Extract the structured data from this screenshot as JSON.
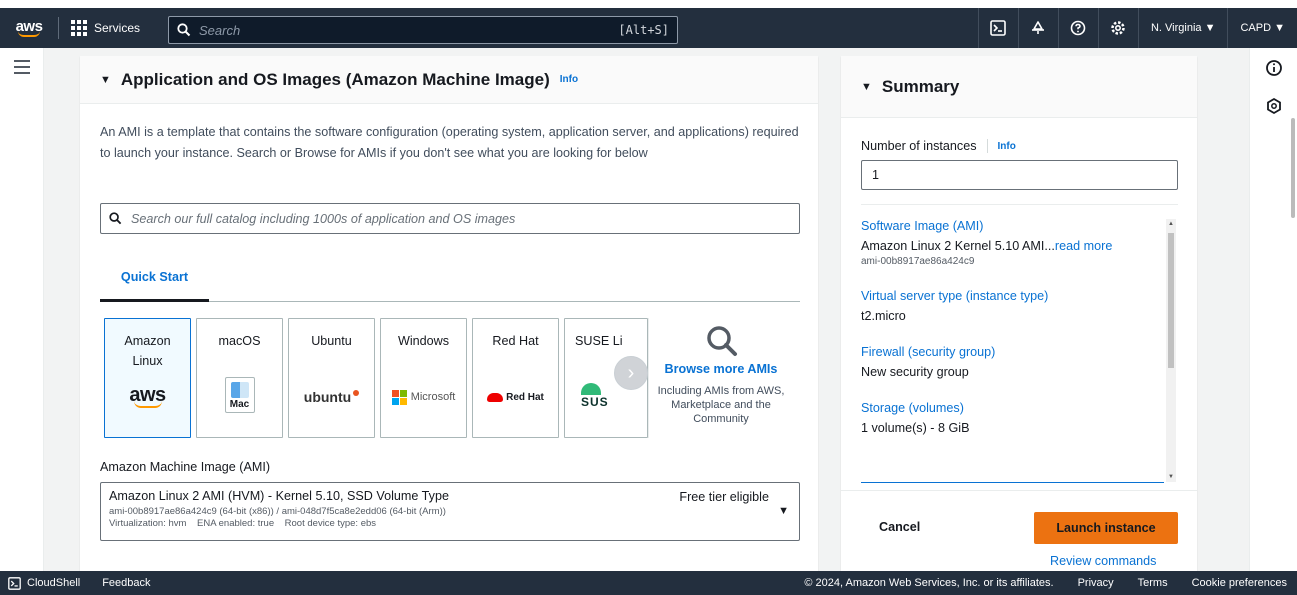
{
  "nav": {
    "logo_text": "aws",
    "services": "Services",
    "search_placeholder": "Search",
    "search_shortcut": "[Alt+S]",
    "region": "N. Virginia ▼",
    "account": "CAPD ▼"
  },
  "main": {
    "title": "Application and OS Images (Amazon Machine Image)",
    "info": "Info",
    "description": "An AMI is a template that contains the software configuration (operating system, application server, and applications) required to launch your instance. Search or Browse for AMIs if you don't see what you are looking for below",
    "catalog_placeholder": "Search our full catalog including 1000s of application and OS images",
    "tab": "Quick Start",
    "tiles": [
      {
        "label": "Amazon Linux",
        "logo": "aws"
      },
      {
        "label": "macOS",
        "logo": "Mac"
      },
      {
        "label": "Ubuntu",
        "logo": "ubuntu"
      },
      {
        "label": "Windows",
        "logo": "Microsoft"
      },
      {
        "label": "Red Hat",
        "logo": "Red Hat"
      },
      {
        "label": "SUSE Li",
        "logo": "SUS"
      }
    ],
    "browse_title": "Browse more AMIs",
    "browse_sub": "Including AMIs from AWS, Marketplace and the Community",
    "ami_label": "Amazon Machine Image (AMI)",
    "ami_name": "Amazon Linux 2 AMI (HVM) - Kernel 5.10, SSD Volume Type",
    "ami_free": "Free tier eligible",
    "ami_ids": "ami-00b8917ae86a424c9 (64-bit (x86)) / ami-048d7f5ca8e2edd06 (64-bit (Arm))",
    "ami_meta": "Virtualization: hvm    ENA enabled: true    Root device type: ebs"
  },
  "summary": {
    "title": "Summary",
    "num_label": "Number of instances",
    "info": "Info",
    "num_value": "1",
    "software_key": "Software Image (AMI)",
    "software_val": "Amazon Linux 2 Kernel 5.10 AMI...",
    "read_more": "read more",
    "software_sub": "ami-00b8917ae86a424c9",
    "server_key": "Virtual server type (instance type)",
    "server_val": "t2.micro",
    "firewall_key": "Firewall (security group)",
    "firewall_val": "New security group",
    "storage_key": "Storage (volumes)",
    "storage_val": "1 volume(s) - 8 GiB",
    "cancel": "Cancel",
    "launch": "Launch instance",
    "review": "Review commands"
  },
  "footer": {
    "cloudshell": "CloudShell",
    "feedback": "Feedback",
    "copyright": "© 2024, Amazon Web Services, Inc. or its affiliates.",
    "privacy": "Privacy",
    "terms": "Terms",
    "cookies": "Cookie preferences"
  },
  "colors": {
    "nav_bg": "#232f3e",
    "link": "#0972d3",
    "launch": "#ec7211",
    "aws_orange": "#ff9900"
  },
  "icons": {
    "services": "grid-icon",
    "search": "search-icon",
    "cloudshell": "cloudshell-icon",
    "notifications": "bell-icon",
    "help": "help-icon",
    "settings": "gear-icon",
    "menu": "hamburger-icon",
    "info_panel": "info-icon",
    "side_panel": "hexagon-icon",
    "next": "chevron-right-icon",
    "browse": "magnifier-icon"
  }
}
